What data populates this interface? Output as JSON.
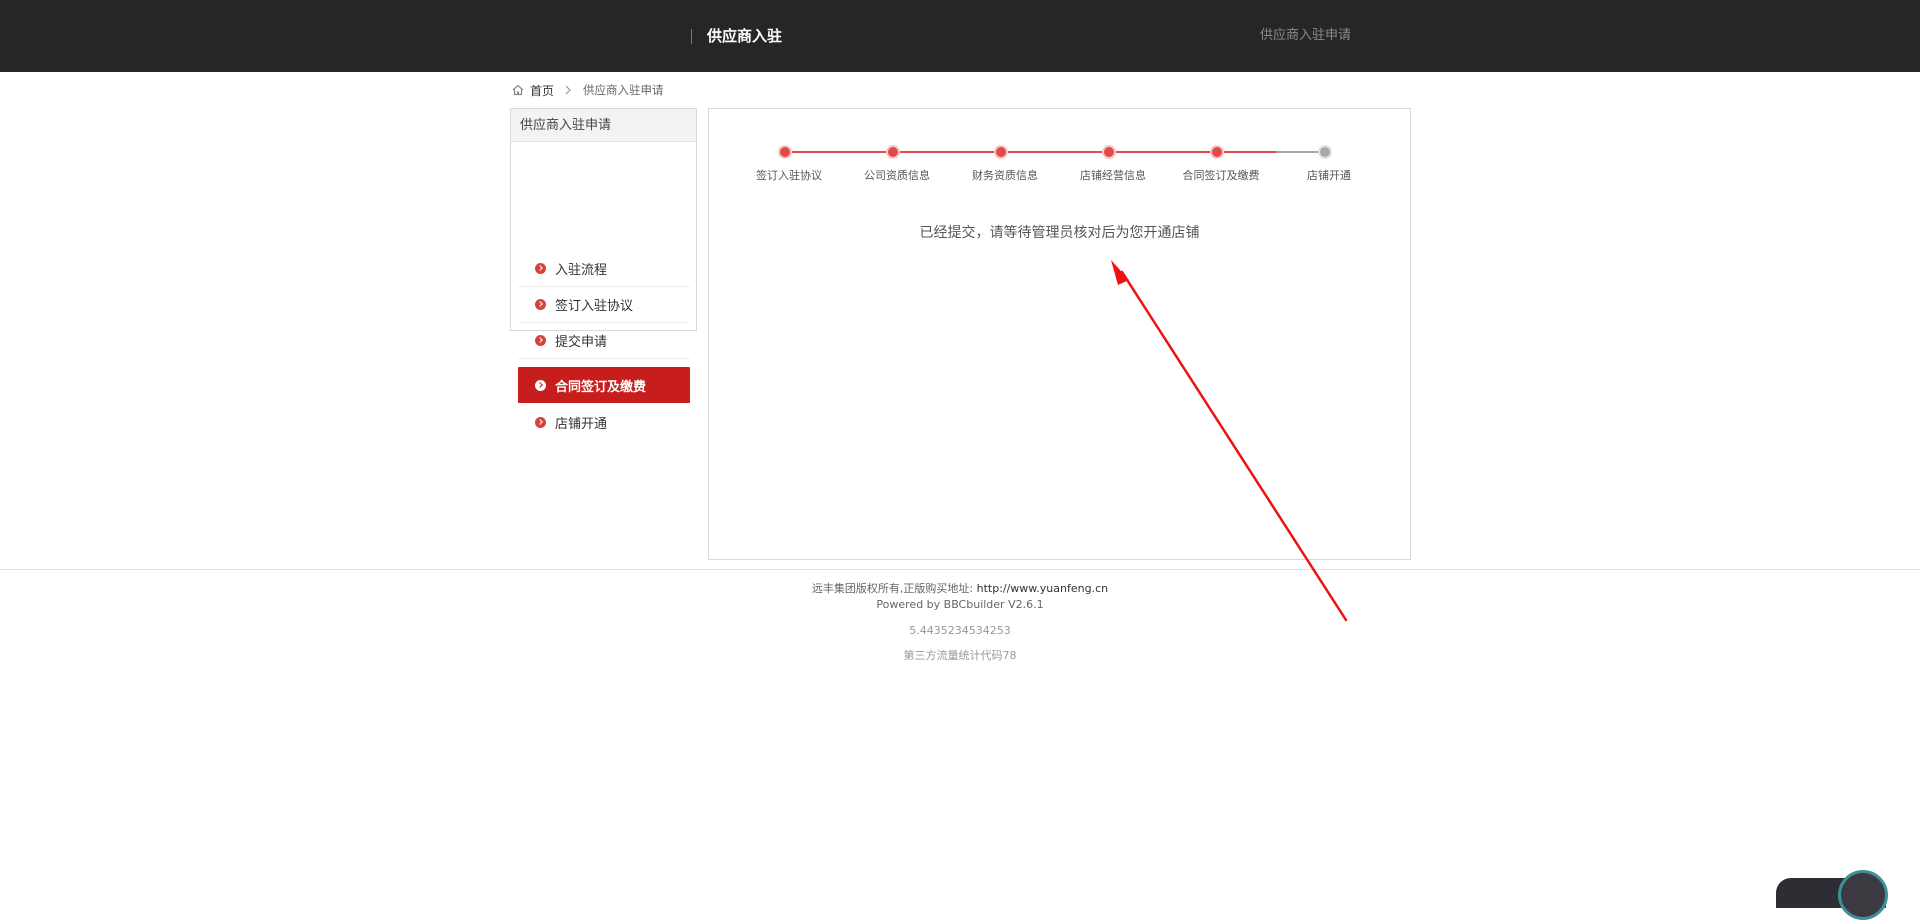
{
  "header": {
    "site_title": "供应商入驻",
    "right_link": "供应商入驻申请"
  },
  "breadcrumb": {
    "home": "首页",
    "current": "供应商入驻申请"
  },
  "sidebar": {
    "title": "供应商入驻申请",
    "items": [
      {
        "label": "入驻流程",
        "active": false
      },
      {
        "label": "签订入驻协议",
        "active": false
      },
      {
        "label": "提交申请",
        "active": false
      },
      {
        "label": "合同签订及缴费",
        "active": true
      },
      {
        "label": "店铺开通",
        "active": false
      }
    ]
  },
  "progress": {
    "steps": [
      {
        "label": "签订入驻协议",
        "done": true
      },
      {
        "label": "公司资质信息",
        "done": true
      },
      {
        "label": "财务资质信息",
        "done": true
      },
      {
        "label": "店铺经营信息",
        "done": true
      },
      {
        "label": "合同签订及缴费",
        "done": true
      },
      {
        "label": "店铺开通",
        "done": false
      }
    ],
    "message": "已经提交，请等待管理员核对后为您开通店铺"
  },
  "footer": {
    "copyright": "远丰集团版权所有,正版购买地址:",
    "url": "http://www.yuanfeng.cn",
    "powered": "Powered by BBCbuilder V2.6.1",
    "timing": "5.4435234534253",
    "stats": "第三方流量统计代码78"
  },
  "colors": {
    "header_bg": "#262626",
    "accent": "#c81d1d",
    "step_done": "#e04a4a",
    "step_pending": "#a8a8a8",
    "arrow": "#ee1111"
  },
  "icons": {
    "home": "home-icon",
    "separator": "chevron-right-icon",
    "sidebar_bullet": "chevron-circle-icon"
  }
}
